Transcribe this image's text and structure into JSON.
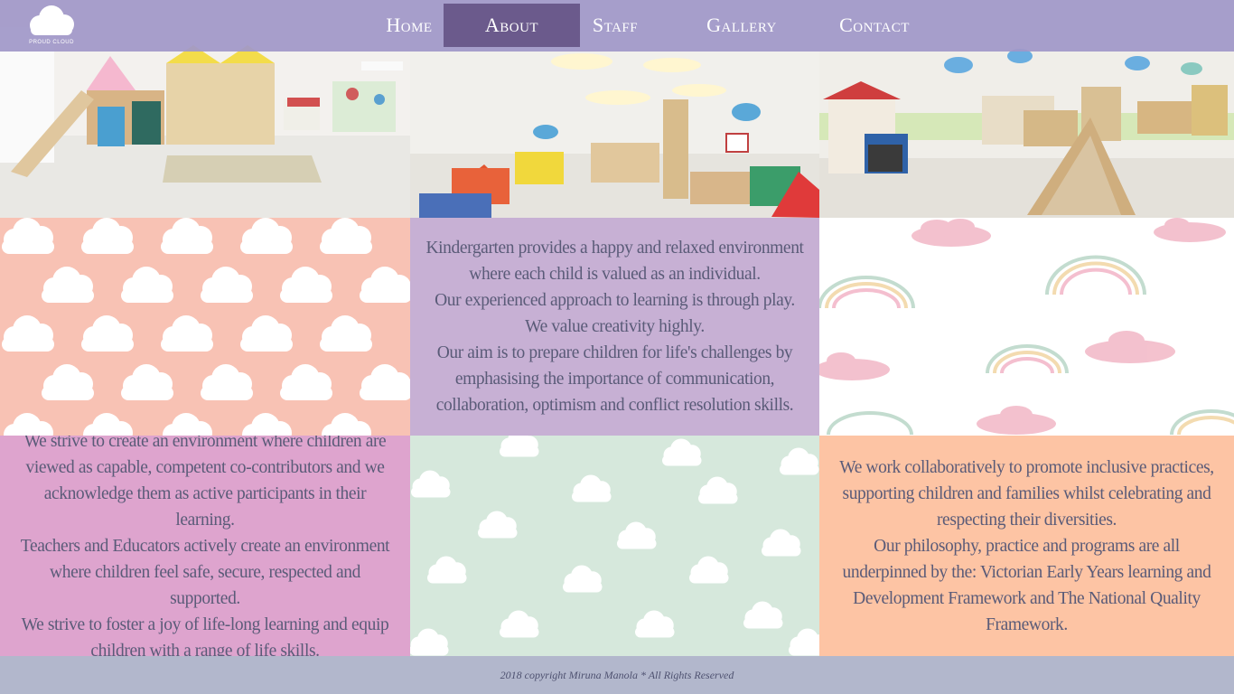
{
  "logo": {
    "text": "PROUD CLOUD"
  },
  "nav": {
    "items": [
      {
        "label": "Home"
      },
      {
        "label": "About"
      },
      {
        "label": "Staff"
      },
      {
        "label": "Gallery"
      },
      {
        "label": "Contact"
      }
    ],
    "active": "About"
  },
  "photos": [
    {
      "name": "playroom-photo"
    },
    {
      "name": "activity-room-photo"
    },
    {
      "name": "classroom-photo"
    }
  ],
  "intro": {
    "lines": [
      "Kindergarten provides a happy and relaxed environment",
      "where each child is valued as an individual.",
      "Our experienced approach to learning is through play.",
      "We value creativity highly.",
      "Our aim is to prepare children for life's challenges by",
      "emphasising the importance of communication,",
      "collaboration, optimism and conflict resolution skills."
    ]
  },
  "strive": {
    "lines": [
      "We strive to create an environment where children are",
      "viewed as capable, competent co-contributors and we",
      "acknowledge them as active participants in their learning.",
      "Teachers and Educators actively create an environment",
      "where children feel safe, secure, respected and supported.",
      "We strive to foster a joy of life-long learning and equip",
      "children with a range of life skills."
    ]
  },
  "philosophy": {
    "lines": [
      "We work collaboratively to promote inclusive practices,",
      "supporting children and families whilst celebrating and",
      "respecting their diversities.",
      "Our philosophy, practice and programs are all",
      "underpinned by the: Victorian Early Years learning and",
      "Development Framework and The National Quality",
      "Framework."
    ]
  },
  "footer": {
    "text": "2018 copyright Miruna Manola * All Rights Reserved"
  },
  "colors": {
    "nav_bg": "#a098c8",
    "nav_active": "#6b5a8c",
    "peach_clouds": "#f8c2b4",
    "lavender_tile": "#c7b0d4",
    "pink_tile": "#dea4ce",
    "mint_clouds": "#d6e8dc",
    "orange_tile": "#fdc4a4",
    "footer_bg": "#b2b7cc"
  }
}
